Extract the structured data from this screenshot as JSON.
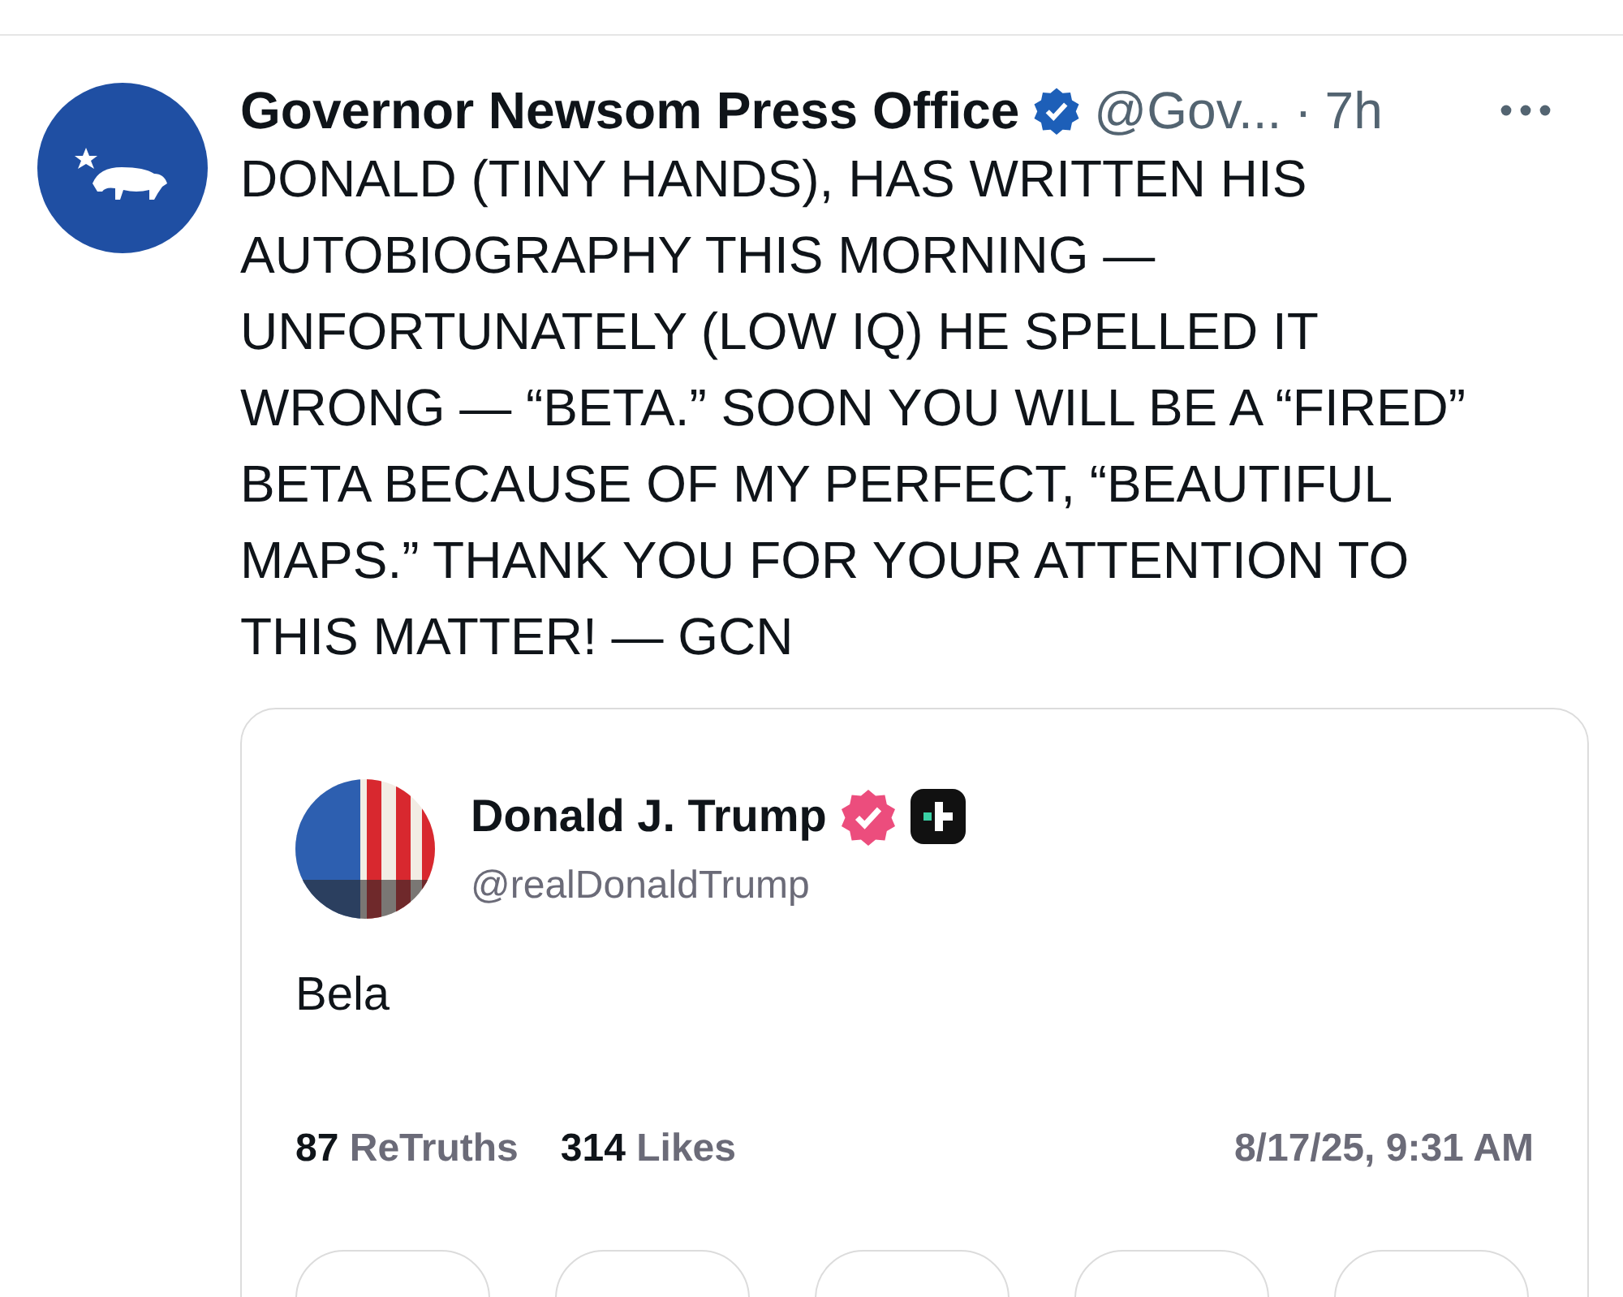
{
  "post": {
    "author": "Governor Newsom Press Office",
    "handle": "@Gov...",
    "separator": "·",
    "time": "7h",
    "text": "DONALD (TINY HANDS), HAS WRITTEN HIS AUTOBIOGRAPHY THIS MORNING — UNFORTUNATELY (LOW IQ) HE SPELLED IT WRONG — “BETA.” SOON YOU WILL BE A “FIRED” BETA BECAUSE OF MY PERFECT, “BEAUTIFUL MAPS.” THANK YOU FOR YOUR ATTENTION TO THIS MATTER! — GCN"
  },
  "quote": {
    "author": "Donald J. Trump",
    "handle": "@realDonaldTrump",
    "text": "Bela",
    "stats": [
      {
        "count": "87",
        "label": "ReTruths"
      },
      {
        "count": "314",
        "label": "Likes"
      }
    ],
    "date": "8/17/25, 9:31 AM"
  }
}
